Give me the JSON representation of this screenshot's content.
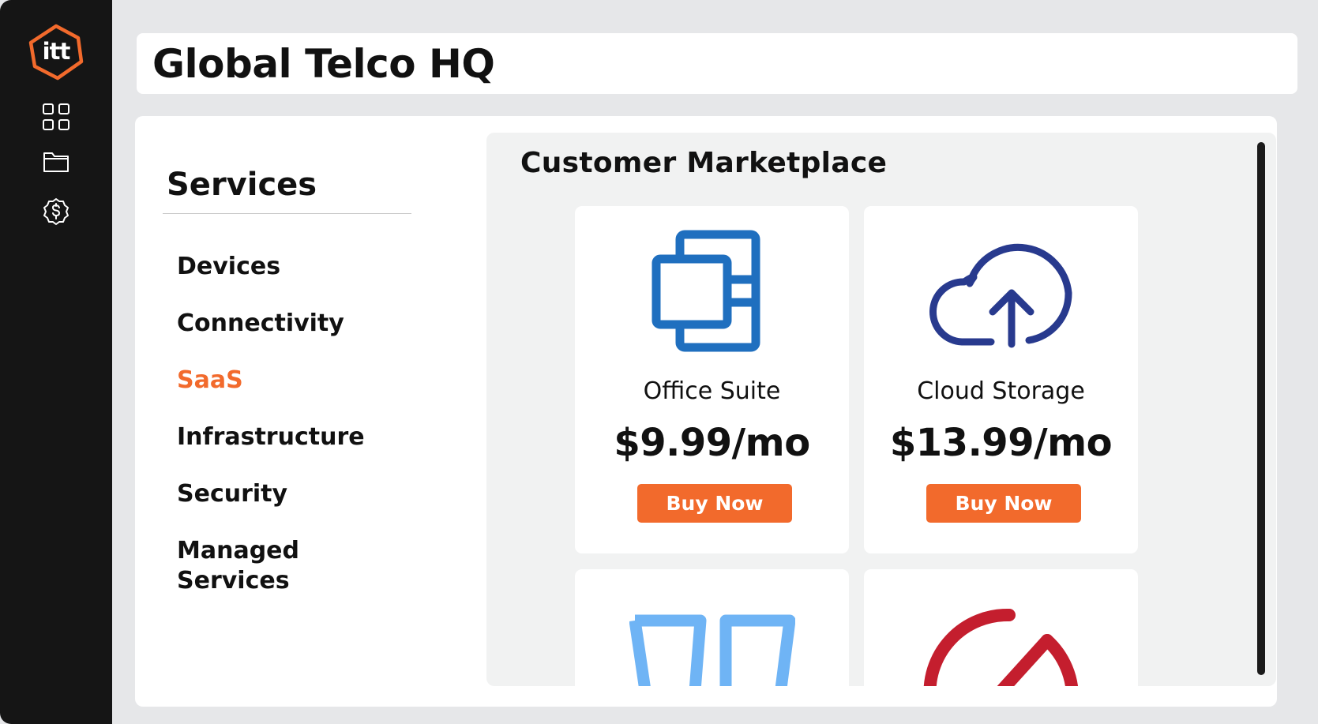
{
  "app": {
    "logo_text": "itt",
    "title": "Global Telco HQ",
    "brand_color": "#f26a2c"
  },
  "nav": {
    "items": [
      {
        "icon": "grid-icon"
      },
      {
        "icon": "folder-icon"
      },
      {
        "icon": "dollar-badge-icon"
      }
    ]
  },
  "services": {
    "title": "Services",
    "items": [
      {
        "label": "Devices",
        "active": false
      },
      {
        "label": "Connectivity",
        "active": false
      },
      {
        "label": "SaaS",
        "active": true
      },
      {
        "label": "Infrastructure",
        "active": false
      },
      {
        "label": "Security",
        "active": false
      },
      {
        "label": "Managed Services",
        "active": false
      }
    ]
  },
  "marketplace": {
    "title": "Customer Marketplace",
    "products": [
      {
        "name": "Office Suite",
        "price": "$9.99/mo",
        "button": "Buy Now",
        "icon": "office-suite-icon",
        "icon_color": "#1f6fbf"
      },
      {
        "name": "Cloud Storage",
        "price": "$13.99/mo",
        "button": "Buy Now",
        "icon": "cloud-upload-icon",
        "icon_color": "#283a8e"
      },
      {
        "icon": "columns-icon",
        "icon_color": "#6fb4f5"
      },
      {
        "icon": "gauge-icon",
        "icon_color": "#c41e2e"
      }
    ]
  }
}
